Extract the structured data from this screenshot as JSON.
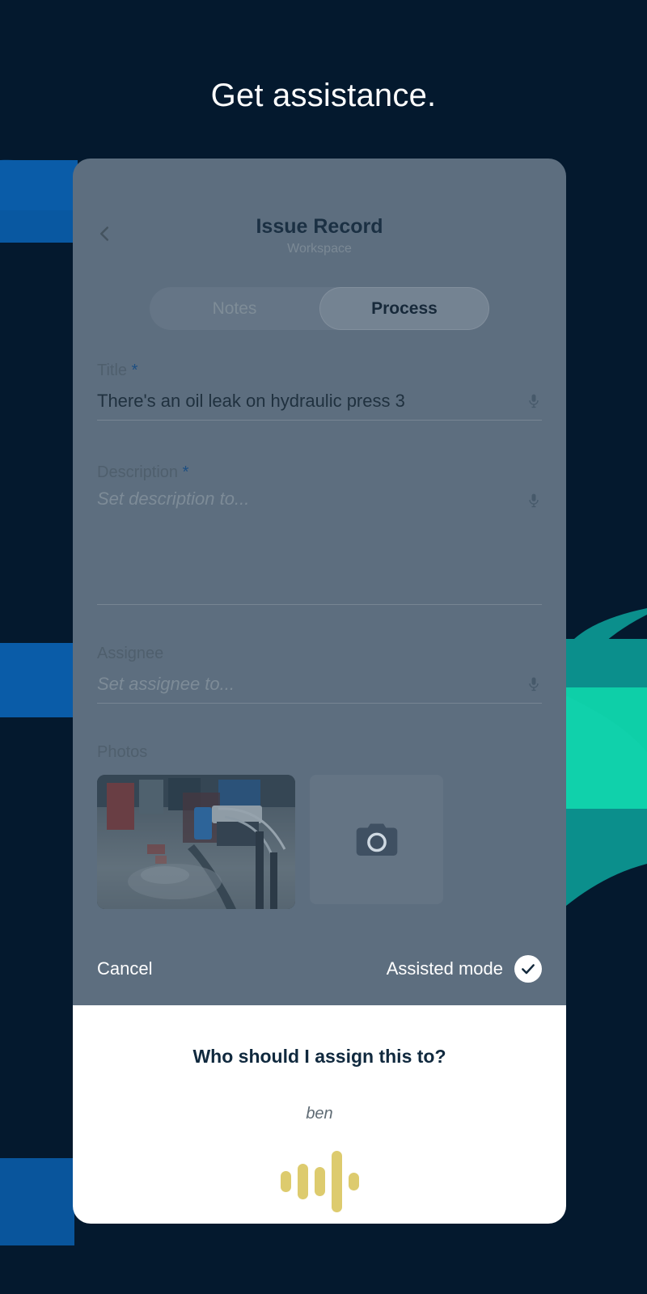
{
  "page": {
    "headline": "Get assistance.",
    "background_color": "#04192e",
    "accent_blue": "#0a5ca8",
    "accent_teal": "#0ecfa8"
  },
  "card": {
    "header": {
      "back_icon": "chevron-left-icon",
      "title": "Issue Record",
      "subtitle": "Workspace"
    },
    "tabs": [
      {
        "label": "Notes",
        "active": false
      },
      {
        "label": "Process",
        "active": true
      }
    ],
    "fields": [
      {
        "label": "Title",
        "required": true,
        "required_marker": "*",
        "value": "There's an oil leak on hydraulic press 3",
        "is_placeholder": false,
        "mic_icon": "microphone-icon"
      },
      {
        "label": "Description",
        "required": true,
        "required_marker": "*",
        "value": "Set description to...",
        "is_placeholder": true,
        "mic_icon": "microphone-icon"
      },
      {
        "label": "Assignee",
        "required": false,
        "required_marker": "",
        "value": "Set assignee to...",
        "is_placeholder": true,
        "mic_icon": "microphone-icon"
      }
    ],
    "photos": {
      "label": "Photos",
      "thumbnail_alt": "industrial-machine-oil-leak-photo",
      "add_icon": "camera-icon"
    },
    "actions": {
      "cancel_label": "Cancel",
      "assisted_label": "Assisted mode",
      "assisted_enabled": true,
      "assisted_icon": "check-circle-icon"
    }
  },
  "sheet": {
    "question": "Who should I assign this to?",
    "transcript": "ben",
    "waveform": {
      "color": "#ddcb6e",
      "bars": [
        26,
        44,
        36,
        76,
        22
      ]
    }
  }
}
